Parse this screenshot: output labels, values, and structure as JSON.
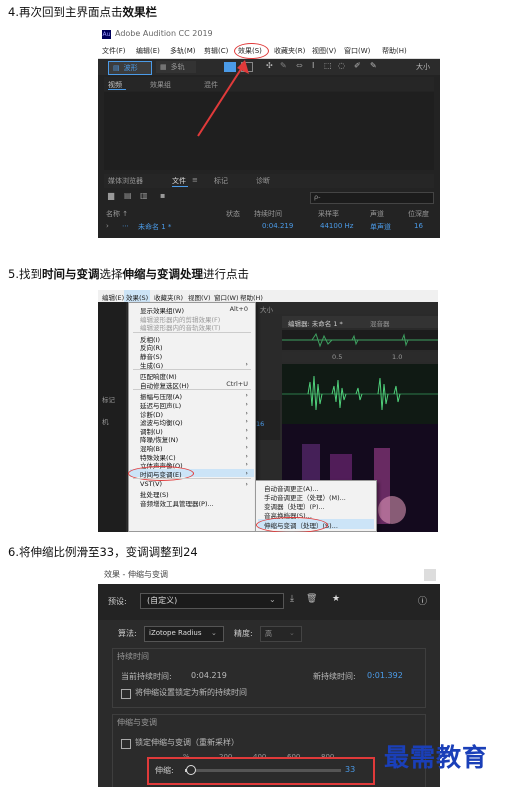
{
  "steps": {
    "s4": {
      "pre": "4.再次回到主界面点击",
      "bold": "效果栏"
    },
    "s5": {
      "pre": "5.找到",
      "bold1": "时间与变调",
      "mid": "选择",
      "bold2": "伸缩与变调处理",
      "post": "进行点击"
    },
    "s6": {
      "text": "6.将伸缩比例滑至33，变调调整到24"
    }
  },
  "shot1": {
    "app_title": "Adobe Audition CC 2019",
    "menu": [
      "文件(F)",
      "编辑(E)",
      "多轨(M)",
      "剪辑(C)",
      "效果(S)",
      "收藏夹(R)",
      "视图(V)",
      "窗口(W)",
      "帮助(H)"
    ],
    "toolbar": {
      "waveform": "波形",
      "multitrack": "多轨",
      "size": "大小"
    },
    "panel_tabs": [
      "视频",
      "效果组",
      "混件"
    ],
    "lower_tabs": [
      "媒体浏览器",
      "文件",
      "标记",
      "诊断"
    ],
    "search_placeholder": "ρ-",
    "columns": [
      "名称 ↑",
      "状态",
      "持续时间",
      "采样率",
      "声道",
      "位深度"
    ],
    "file_row": {
      "name": "未命名 1 *",
      "status": "",
      "duration": "0:04.219",
      "rate": "44100 Hz",
      "channel": "单声道",
      "depth": "16"
    }
  },
  "shot2": {
    "menubar": [
      "编辑(E)",
      "效果(S)",
      "收藏夹(R)",
      "视图(V)",
      "窗口(W)",
      "帮助(H)"
    ],
    "menu_items": [
      {
        "label": "显示效果组(W)",
        "shortcut": "Alt+0"
      },
      {
        "label": "编辑波形器内的剪辑效果(F)",
        "shortcut": "",
        "disabled": true
      },
      {
        "label": "编辑波形器内的音轨效果(T)",
        "shortcut": "",
        "disabled": true
      },
      {
        "label": "---"
      },
      {
        "label": "反相(I)",
        "shortcut": ""
      },
      {
        "label": "反向(R)",
        "shortcut": ""
      },
      {
        "label": "静音(S)",
        "shortcut": ""
      },
      {
        "label": "生成(G)",
        "shortcut": "›"
      },
      {
        "label": "---"
      },
      {
        "label": "匹配响度(M)",
        "shortcut": ""
      },
      {
        "label": "自动修复选区(H)",
        "shortcut": "Ctrl+U"
      },
      {
        "label": "---"
      },
      {
        "label": "振幅与压限(A)",
        "shortcut": "›"
      },
      {
        "label": "延迟与回声(L)",
        "shortcut": "›"
      },
      {
        "label": "诊断(D)",
        "shortcut": "›"
      },
      {
        "label": "滤波与均衡(Q)",
        "shortcut": "›"
      },
      {
        "label": "调制(U)",
        "shortcut": "›"
      },
      {
        "label": "降噪/恢复(N)",
        "shortcut": "›"
      },
      {
        "label": "混响(B)",
        "shortcut": "›"
      },
      {
        "label": "特殊效果(C)",
        "shortcut": "›"
      },
      {
        "label": "立体声声像(O)",
        "shortcut": "›"
      },
      {
        "label": "时间与变调(E)",
        "shortcut": "›"
      },
      {
        "label": "---"
      },
      {
        "label": "VST(V)",
        "shortcut": "›"
      },
      {
        "label": "批处理(S)",
        "shortcut": ""
      },
      {
        "label": "音频增效工具管理器(P)...",
        "shortcut": ""
      }
    ],
    "submenu": [
      "自动音调更正(A)...",
      "手动音调更正（处理）(M)...",
      "变调器（处理）(P)...",
      "音高换档器(S)...",
      "伸缩与变调（处理）(S)..."
    ],
    "editor_tab": "编辑器: 未命名 1 *",
    "mixer_tab": "混音器",
    "size_label": "大小",
    "ruler": [
      "0.5",
      "1.0"
    ],
    "side_labels": [
      "标记",
      "机",
      "16"
    ]
  },
  "shot3": {
    "title": "效果 - 伸缩与变调",
    "preset_label": "预设:",
    "preset_value": "(自定义)",
    "algorithm_label": "算法:",
    "algorithm_value": "iZotope Radius",
    "precision_label": "精度:",
    "precision_value": "高",
    "duration_group": "持续时间",
    "current_label": "当前持续时间:",
    "current_value": "0:04.219",
    "new_label": "新持续时间:",
    "new_value": "0:01.392",
    "lock_label": "将伸缩设置锁定为新的持续时间",
    "stretch_group": "伸缩与变调",
    "lock_stretch_label": "锁定伸缩与变调（重新采样）",
    "stretch_label": "伸缩:",
    "stretch_unit": "%",
    "stretch_ticks": [
      "200",
      "400",
      "600",
      "800"
    ],
    "stretch_value": "33",
    "stretch_fraction": 0.033
  },
  "watermark": "最需教育",
  "colors": {
    "accent": "#4b9be8",
    "highlight": "#e03a3a",
    "dark": "#232323",
    "panel": "#2b2b2b"
  }
}
